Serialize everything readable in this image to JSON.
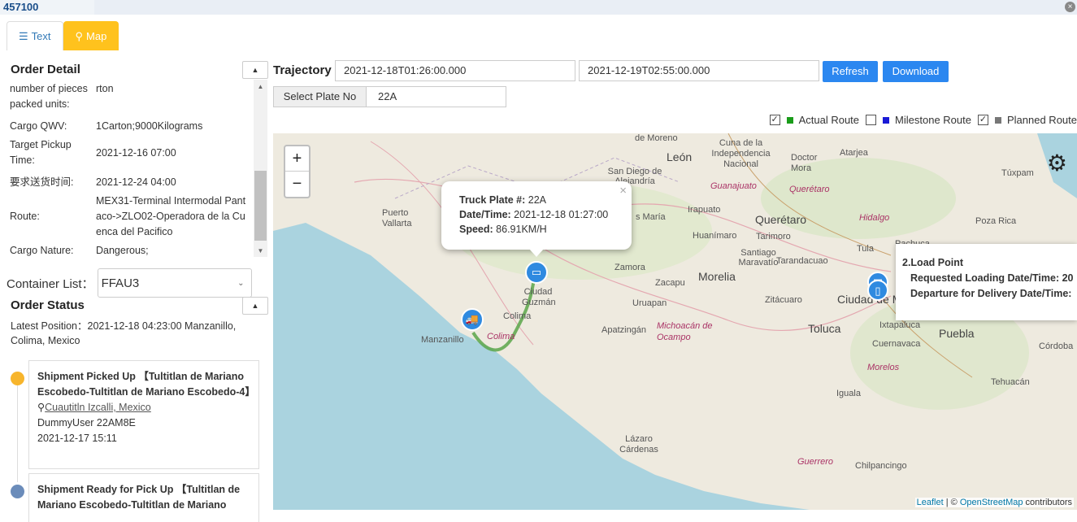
{
  "header": {
    "order_id": "457100"
  },
  "tabs": [
    {
      "label": "Text",
      "icon": "list-icon"
    },
    {
      "label": "Map",
      "icon": "map-marker-icon"
    }
  ],
  "order_detail": {
    "title": "Order Detail",
    "rows": [
      {
        "key": "number of pieces",
        "value": "rton"
      },
      {
        "key": "packed units:",
        "value": ""
      },
      {
        "key": "Cargo QWV:",
        "value": "1Carton;9000Kilograms"
      },
      {
        "key": "Target Pickup Time:",
        "value": "2021-12-16 07:00"
      },
      {
        "key": "要求送货时间:",
        "value": "2021-12-24 04:00"
      },
      {
        "key": "Route:",
        "value": "MEX31-Terminal Intermodal Pantaco->ZLO02-Operadora de la Cuenca del Pacifico"
      },
      {
        "key": "Cargo Nature:",
        "value": "Dangerous;"
      }
    ]
  },
  "container_list": {
    "label": "Container List：",
    "selected": "FFAU3"
  },
  "order_status": {
    "title": "Order Status",
    "latest_position": "Latest Position：2021-12-18 04:23:00 Manzanillo, Colima, Mexico",
    "events": [
      {
        "title": "Shipment Picked Up 【Tultitlan de Mariano Escobedo-Tultitlan de Mariano Escobedo-4】",
        "location": "Cuautitln Izcalli, Mexico",
        "user": "DummyUser 22AM8E",
        "time": "2021-12-17 15:11",
        "color": "#f7b52c"
      },
      {
        "title": "Shipment Ready for Pick Up 【Tultitlan de Mariano Escobedo-Tultitlan de Mariano",
        "color": "#6b8cba"
      }
    ]
  },
  "trajectory": {
    "label": "Trajectory",
    "start": "2021-12-18T01:26:00.000",
    "end": "2021-12-19T02:55:00.000",
    "refresh": "Refresh",
    "download": "Download",
    "plate_label": "Select Plate No",
    "plate_value": "22A"
  },
  "routes": {
    "actual": {
      "label": "Actual Route",
      "checked": true,
      "color": "#1a9c1a"
    },
    "milestone": {
      "label": "Milestone Route",
      "checked": false,
      "color": "#1a1ad6"
    },
    "planned": {
      "label": "Planned Route",
      "checked": true,
      "color": "#777777"
    }
  },
  "map": {
    "labels": [
      "de Moreno",
      "Cuna de la Independencia Nacional",
      "León",
      "Doctor Mora",
      "Atarjea",
      "San Diego de Alejandría",
      "Guanajuato",
      "Querétaro",
      "Túxpam",
      "Puerto Vallarta",
      "Irapuato",
      "Querétaro",
      "Hidalgo",
      "Poza Rica",
      "s María",
      "Huanímaro",
      "Tarimoro",
      "Tula",
      "Pachuca",
      "Santiago Maravatío",
      "Tarandacuao",
      "Zamora",
      "Zacapu",
      "Morelia",
      "Ciudad Guzmán",
      "Colima",
      "Uruapan",
      "Zitácuaro",
      "Toluca",
      "Ciudad de M",
      "Ixtapaluca",
      "Puebla",
      "Manzanillo",
      "Colima",
      "Apatzingán",
      "Michoacán de Ocampo",
      "Cuernavaca",
      "Morelos",
      "Córdoba",
      "Tehuacán",
      "Iguala",
      "Lázaro Cárdenas",
      "Guerrero",
      "Chilpancingo"
    ],
    "popup": {
      "plate_label": "Truck Plate #:",
      "plate": "22A",
      "datetime_label": "Date/Time:",
      "datetime": "2021-12-18 01:27:00",
      "speed_label": "Speed:",
      "speed": "86.91KM/H"
    },
    "tooltip": {
      "title": "2.Load Point",
      "line1": "Requested Loading Date/Time: 20",
      "line2": "Departure for Delivery Date/Time:"
    },
    "attribution": {
      "leaflet": "Leaflet",
      "sep": " | © ",
      "osm": "OpenStreetMap",
      "tail": " contributors"
    }
  }
}
